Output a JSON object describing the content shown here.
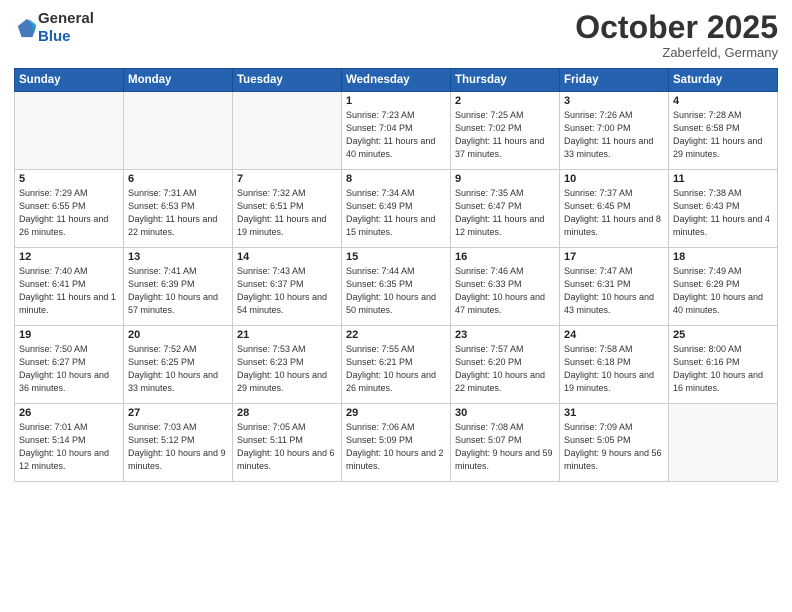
{
  "header": {
    "logo_general": "General",
    "logo_blue": "Blue",
    "month_title": "October 2025",
    "location": "Zaberfeld, Germany"
  },
  "weekdays": [
    "Sunday",
    "Monday",
    "Tuesday",
    "Wednesday",
    "Thursday",
    "Friday",
    "Saturday"
  ],
  "weeks": [
    [
      {
        "day": "",
        "info": ""
      },
      {
        "day": "",
        "info": ""
      },
      {
        "day": "",
        "info": ""
      },
      {
        "day": "1",
        "info": "Sunrise: 7:23 AM\nSunset: 7:04 PM\nDaylight: 11 hours\nand 40 minutes."
      },
      {
        "day": "2",
        "info": "Sunrise: 7:25 AM\nSunset: 7:02 PM\nDaylight: 11 hours\nand 37 minutes."
      },
      {
        "day": "3",
        "info": "Sunrise: 7:26 AM\nSunset: 7:00 PM\nDaylight: 11 hours\nand 33 minutes."
      },
      {
        "day": "4",
        "info": "Sunrise: 7:28 AM\nSunset: 6:58 PM\nDaylight: 11 hours\nand 29 minutes."
      }
    ],
    [
      {
        "day": "5",
        "info": "Sunrise: 7:29 AM\nSunset: 6:55 PM\nDaylight: 11 hours\nand 26 minutes."
      },
      {
        "day": "6",
        "info": "Sunrise: 7:31 AM\nSunset: 6:53 PM\nDaylight: 11 hours\nand 22 minutes."
      },
      {
        "day": "7",
        "info": "Sunrise: 7:32 AM\nSunset: 6:51 PM\nDaylight: 11 hours\nand 19 minutes."
      },
      {
        "day": "8",
        "info": "Sunrise: 7:34 AM\nSunset: 6:49 PM\nDaylight: 11 hours\nand 15 minutes."
      },
      {
        "day": "9",
        "info": "Sunrise: 7:35 AM\nSunset: 6:47 PM\nDaylight: 11 hours\nand 12 minutes."
      },
      {
        "day": "10",
        "info": "Sunrise: 7:37 AM\nSunset: 6:45 PM\nDaylight: 11 hours\nand 8 minutes."
      },
      {
        "day": "11",
        "info": "Sunrise: 7:38 AM\nSunset: 6:43 PM\nDaylight: 11 hours\nand 4 minutes."
      }
    ],
    [
      {
        "day": "12",
        "info": "Sunrise: 7:40 AM\nSunset: 6:41 PM\nDaylight: 11 hours\nand 1 minute."
      },
      {
        "day": "13",
        "info": "Sunrise: 7:41 AM\nSunset: 6:39 PM\nDaylight: 10 hours\nand 57 minutes."
      },
      {
        "day": "14",
        "info": "Sunrise: 7:43 AM\nSunset: 6:37 PM\nDaylight: 10 hours\nand 54 minutes."
      },
      {
        "day": "15",
        "info": "Sunrise: 7:44 AM\nSunset: 6:35 PM\nDaylight: 10 hours\nand 50 minutes."
      },
      {
        "day": "16",
        "info": "Sunrise: 7:46 AM\nSunset: 6:33 PM\nDaylight: 10 hours\nand 47 minutes."
      },
      {
        "day": "17",
        "info": "Sunrise: 7:47 AM\nSunset: 6:31 PM\nDaylight: 10 hours\nand 43 minutes."
      },
      {
        "day": "18",
        "info": "Sunrise: 7:49 AM\nSunset: 6:29 PM\nDaylight: 10 hours\nand 40 minutes."
      }
    ],
    [
      {
        "day": "19",
        "info": "Sunrise: 7:50 AM\nSunset: 6:27 PM\nDaylight: 10 hours\nand 36 minutes."
      },
      {
        "day": "20",
        "info": "Sunrise: 7:52 AM\nSunset: 6:25 PM\nDaylight: 10 hours\nand 33 minutes."
      },
      {
        "day": "21",
        "info": "Sunrise: 7:53 AM\nSunset: 6:23 PM\nDaylight: 10 hours\nand 29 minutes."
      },
      {
        "day": "22",
        "info": "Sunrise: 7:55 AM\nSunset: 6:21 PM\nDaylight: 10 hours\nand 26 minutes."
      },
      {
        "day": "23",
        "info": "Sunrise: 7:57 AM\nSunset: 6:20 PM\nDaylight: 10 hours\nand 22 minutes."
      },
      {
        "day": "24",
        "info": "Sunrise: 7:58 AM\nSunset: 6:18 PM\nDaylight: 10 hours\nand 19 minutes."
      },
      {
        "day": "25",
        "info": "Sunrise: 8:00 AM\nSunset: 6:16 PM\nDaylight: 10 hours\nand 16 minutes."
      }
    ],
    [
      {
        "day": "26",
        "info": "Sunrise: 7:01 AM\nSunset: 5:14 PM\nDaylight: 10 hours\nand 12 minutes."
      },
      {
        "day": "27",
        "info": "Sunrise: 7:03 AM\nSunset: 5:12 PM\nDaylight: 10 hours\nand 9 minutes."
      },
      {
        "day": "28",
        "info": "Sunrise: 7:05 AM\nSunset: 5:11 PM\nDaylight: 10 hours\nand 6 minutes."
      },
      {
        "day": "29",
        "info": "Sunrise: 7:06 AM\nSunset: 5:09 PM\nDaylight: 10 hours\nand 2 minutes."
      },
      {
        "day": "30",
        "info": "Sunrise: 7:08 AM\nSunset: 5:07 PM\nDaylight: 9 hours\nand 59 minutes."
      },
      {
        "day": "31",
        "info": "Sunrise: 7:09 AM\nSunset: 5:05 PM\nDaylight: 9 hours\nand 56 minutes."
      },
      {
        "day": "",
        "info": ""
      }
    ]
  ]
}
